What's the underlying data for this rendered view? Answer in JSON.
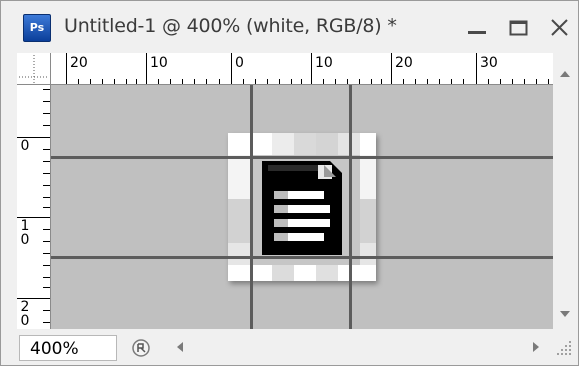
{
  "window": {
    "app_icon_text": "Ps",
    "title": "Untitled-1 @ 400% (white, RGB/8) *",
    "controls": [
      "minimize",
      "maximize",
      "close"
    ]
  },
  "rulers": {
    "horizontal": [
      "20",
      "10",
      "0",
      "10",
      "20",
      "30"
    ],
    "vertical": [
      [
        "0"
      ],
      [
        "1",
        "0"
      ],
      [
        "2",
        "0"
      ]
    ]
  },
  "status": {
    "zoom": "400%"
  },
  "icons": {
    "app": "photoshop-icon",
    "minimize": "minimize-icon",
    "maximize": "maximize-icon",
    "close": "close-icon",
    "document": "document-icon"
  },
  "colors": {
    "pasteboard": "#c0c0c0",
    "guides": "#5c5c5c",
    "app_icon": "#1a5bc4"
  }
}
